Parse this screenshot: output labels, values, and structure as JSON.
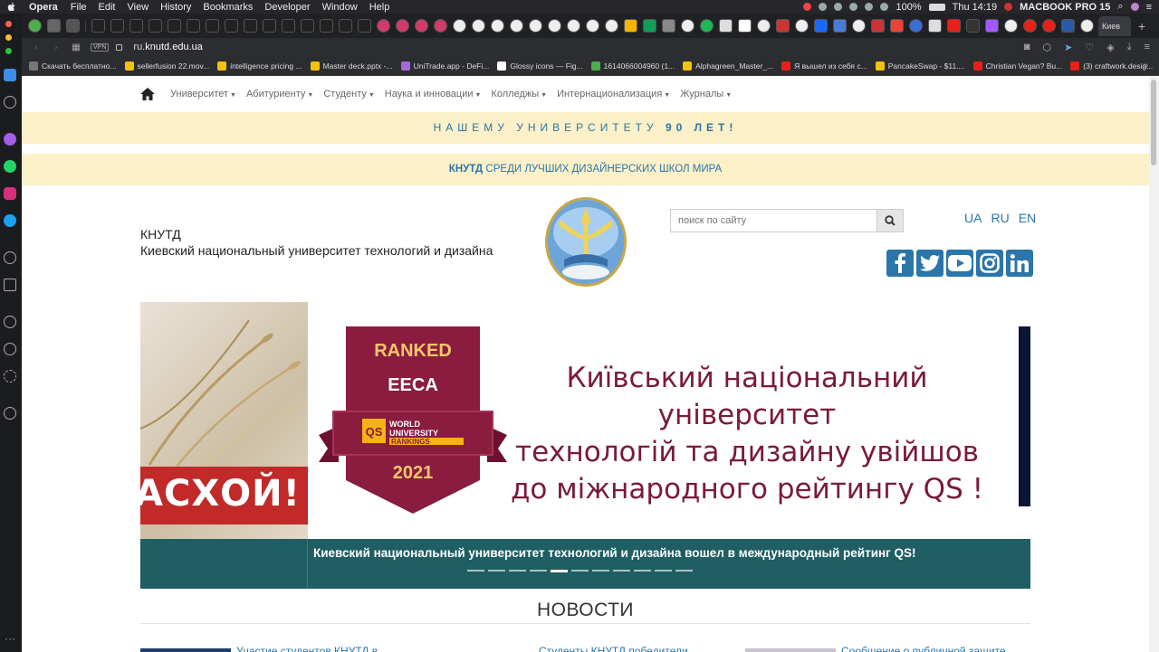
{
  "menubar": {
    "app": "Opera",
    "items": [
      "File",
      "Edit",
      "View",
      "History",
      "Bookmarks",
      "Developer",
      "Window",
      "Help"
    ],
    "battery": "100%",
    "clock": "Thu 14:19",
    "machine": "MACBOOK PRO 15"
  },
  "tabs": {
    "active_label": "Киев"
  },
  "address": {
    "vpn": "VPN",
    "url_prefix": "ru.",
    "url_host": "knutd.edu.ua"
  },
  "bookmarks": [
    {
      "label": "Скачать бесплатно...",
      "color": "#777"
    },
    {
      "label": "sellerfusion 22.mov...",
      "color": "#f4c20d"
    },
    {
      "label": "intelligence pricing ...",
      "color": "#f4c20d"
    },
    {
      "label": "Master deck.pptx -...",
      "color": "#f4c20d"
    },
    {
      "label": "UniTrade.app - DeFi...",
      "color": "#a46bd8"
    },
    {
      "label": "Glossy icons — Fig...",
      "color": "#fff"
    },
    {
      "label": "1614066004960 (1...",
      "color": "#4caf50"
    },
    {
      "label": "Alphagreen_Master_...",
      "color": "#f4c20d"
    },
    {
      "label": "Я вышел из себя с...",
      "color": "#e62117"
    },
    {
      "label": "PancakeSwap - $11....",
      "color": "#f4c20d"
    },
    {
      "label": "Christian Vegan? Bu...",
      "color": "#e62117"
    },
    {
      "label": "(3) craftwork.desig...",
      "color": "#e62117"
    }
  ],
  "site": {
    "nav": [
      "Университет",
      "Абитуриенту",
      "Студенту",
      "Наука и инновации",
      "Колледжы",
      "Интернационализация",
      "Журналы"
    ],
    "banner90_text": "НАШЕМУ УНИВЕРСИТЕТУ",
    "banner90_bold": "90 ЛЕТ!",
    "bannerTop_bold": "КНУТД",
    "bannerTop_text": "СРЕДИ ЛУЧШИХ ДИЗАЙНЕРСКИХ ШКОЛ МИРА",
    "brand_short": "КНУТД",
    "brand_full": "Киевский национальный университет технологий и дизайна",
    "search_placeholder": "поиск по сайту",
    "langs": [
      "UA",
      "RU",
      "EN"
    ],
    "socials": [
      "facebook-icon",
      "twitter-icon",
      "youtube-icon",
      "instagram-icon",
      "linkedin-icon"
    ]
  },
  "slider": {
    "left_partial_text": "АСХОЙ!",
    "badge_ranked": "RANKED",
    "badge_region": "EECA",
    "badge_qs": "QS",
    "badge_world": "WORLD",
    "badge_university": "UNIVERSITY",
    "badge_rankings": "RANKINGS",
    "badge_year": "2021",
    "slide_lines": [
      "Київський національний університет",
      "технологій та дизайну увійшов",
      "до міжнародного рейтингу QS !"
    ],
    "caption": "Киевский национальный университет технологий и дизайна вошел в международный рейтинг QS!",
    "dots_count": 11,
    "active_dot": 4
  },
  "news": {
    "title": "НОВОСТИ",
    "items": [
      "Участие студентов КНУТД в...",
      "Студенты КНУТД победители...",
      "Сообщение о публичной защите..."
    ]
  }
}
